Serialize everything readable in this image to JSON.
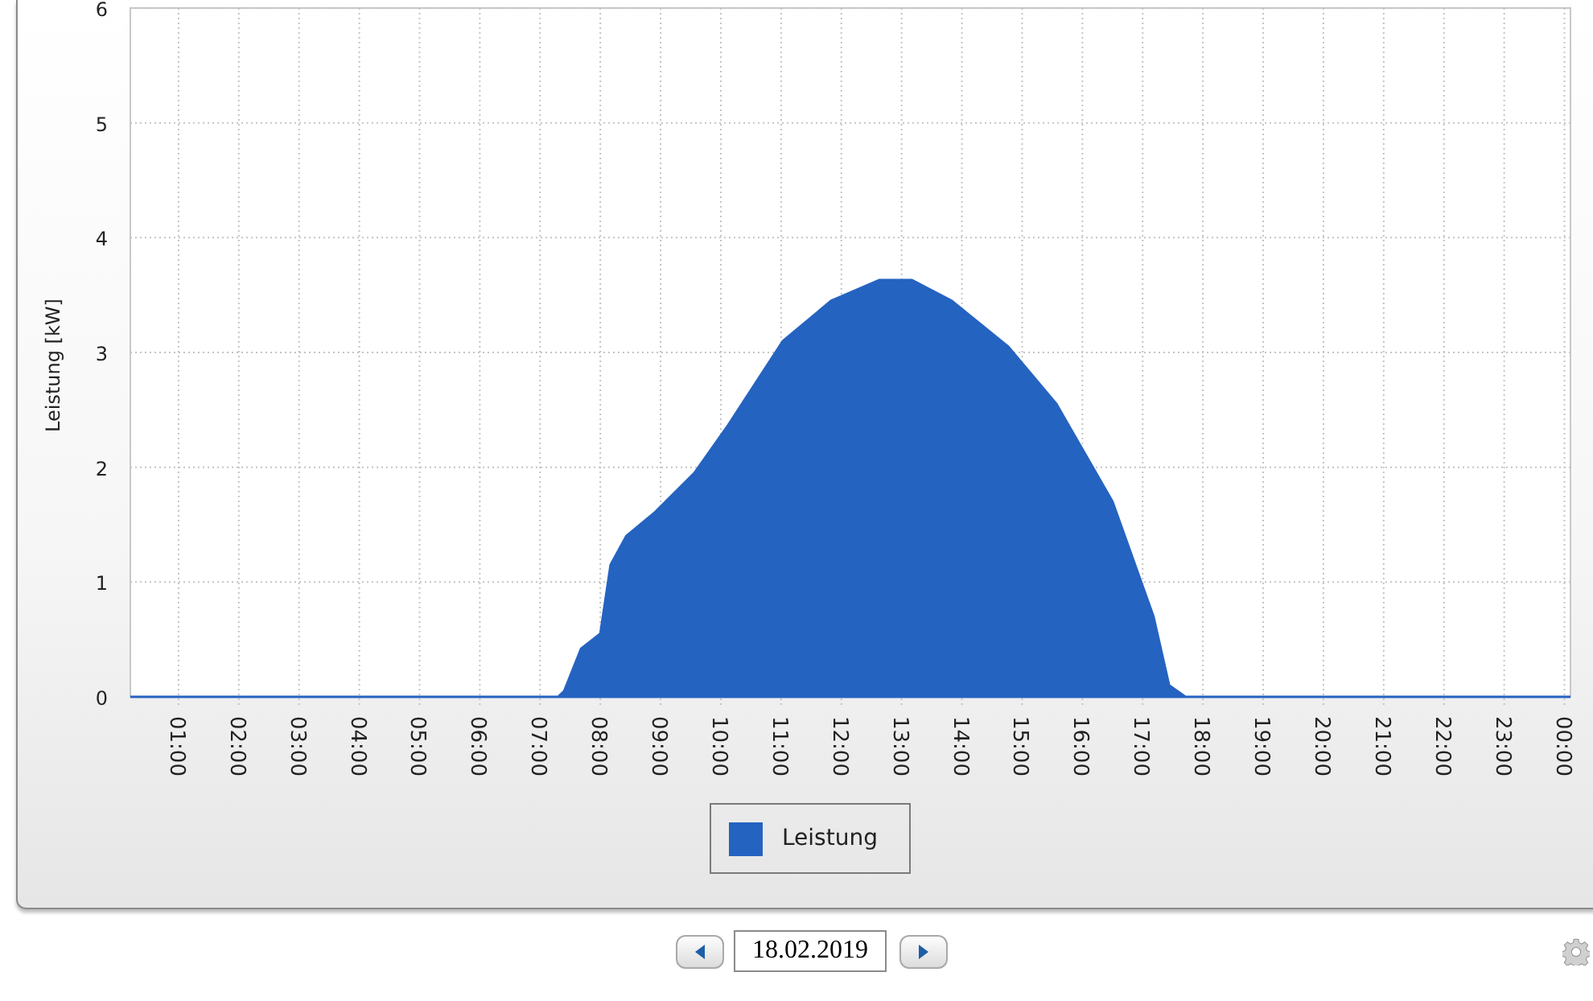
{
  "chart": {
    "chart_data": {
      "type": "area",
      "ylabel": "Leistung [kW]",
      "x": [
        0.2,
        7.3,
        7.4,
        7.68,
        8.0,
        8.17,
        8.43,
        8.89,
        9.56,
        10.1,
        11.03,
        11.83,
        12.63,
        13.17,
        13.83,
        14.77,
        15.57,
        16.5,
        17.18,
        17.44,
        17.71,
        24.1
      ],
      "series": [
        {
          "name": "Leistung",
          "color": "#2563c1",
          "values": [
            0,
            0,
            0.05,
            0.42,
            0.55,
            1.15,
            1.4,
            1.6,
            1.95,
            2.35,
            3.1,
            3.45,
            3.63,
            3.63,
            3.45,
            3.05,
            2.55,
            1.7,
            0.7,
            0.1,
            0,
            0
          ]
        }
      ],
      "xlim": [
        0.2,
        24.1
      ],
      "grid": true,
      "ylim": [
        0,
        6
      ],
      "yticks": [
        0,
        1,
        2,
        3,
        4,
        5,
        6
      ],
      "xticks": [
        {
          "value": 1,
          "label": "01:00"
        },
        {
          "value": 2,
          "label": "02:00"
        },
        {
          "value": 3,
          "label": "03:00"
        },
        {
          "value": 4,
          "label": "04:00"
        },
        {
          "value": 5,
          "label": "05:00"
        },
        {
          "value": 6,
          "label": "06:00"
        },
        {
          "value": 7,
          "label": "07:00"
        },
        {
          "value": 8,
          "label": "08:00"
        },
        {
          "value": 9,
          "label": "09:00"
        },
        {
          "value": 10,
          "label": "10:00"
        },
        {
          "value": 11,
          "label": "11:00"
        },
        {
          "value": 12,
          "label": "12:00"
        },
        {
          "value": 13,
          "label": "13:00"
        },
        {
          "value": 14,
          "label": "14:00"
        },
        {
          "value": 15,
          "label": "15:00"
        },
        {
          "value": 16,
          "label": "16:00"
        },
        {
          "value": 17,
          "label": "17:00"
        },
        {
          "value": 18,
          "label": "18:00"
        },
        {
          "value": 19,
          "label": "19:00"
        },
        {
          "value": 20,
          "label": "20:00"
        },
        {
          "value": 21,
          "label": "21:00"
        },
        {
          "value": 22,
          "label": "22:00"
        },
        {
          "value": 23,
          "label": "23:00"
        },
        {
          "value": 24,
          "label": "00:00"
        }
      ]
    }
  },
  "date_field": {
    "value": "18.02.2019"
  }
}
